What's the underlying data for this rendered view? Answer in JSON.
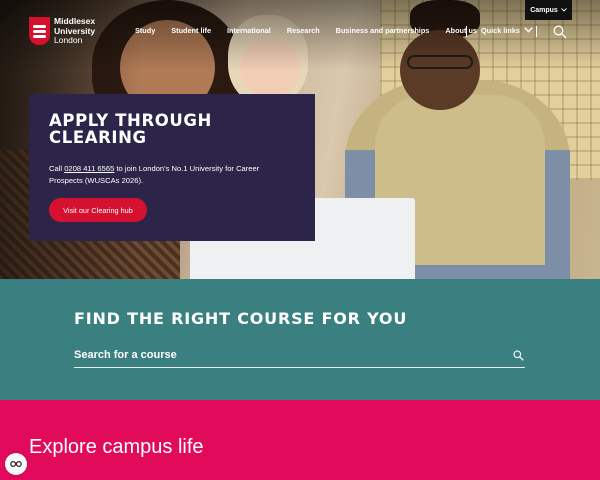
{
  "header": {
    "logo": {
      "line1": "Middlesex",
      "line2": "University",
      "line3": "London"
    },
    "campus_label": "Campus",
    "nav": [
      "Study",
      "Student life",
      "International",
      "Research",
      "Business and partnerships",
      "About us"
    ],
    "quick_links_label": "Quick links"
  },
  "hero": {
    "title": "APPLY THROUGH CLEARING",
    "text_before_phone": "Call ",
    "phone": "0208 411 6565",
    "text_after_phone": " to join London's No.1 University for Career Prospects (WUSCAs 2026).",
    "cta_label": "Visit our Clearing hub"
  },
  "course_search": {
    "title": "FIND THE RIGHT COURSE FOR YOU",
    "placeholder": "Search for a course"
  },
  "campus_life": {
    "title": "Explore campus life"
  },
  "colors": {
    "brand_red": "#d6112f",
    "callout_bg": "#2c2549",
    "teal": "#3b8080",
    "pink": "#e20a5a"
  }
}
